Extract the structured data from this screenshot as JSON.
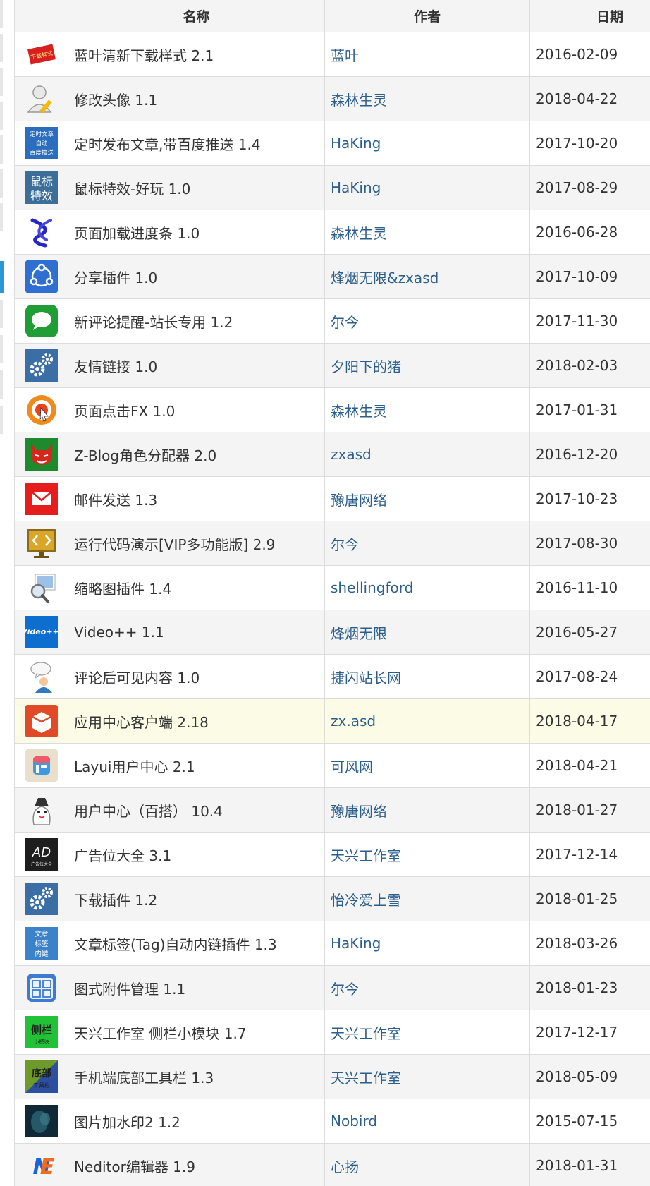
{
  "table": {
    "headers": {
      "name": "名称",
      "author": "作者",
      "date": "日期"
    },
    "rows": [
      {
        "icon": "download-style-icon",
        "name": "蓝叶清新下载样式 2.1",
        "author": "蓝叶",
        "date": "2016-02-09",
        "icon_text": "下载样式"
      },
      {
        "icon": "edit-avatar-icon",
        "name": "修改头像 1.1",
        "author": "森林生灵",
        "date": "2018-04-22"
      },
      {
        "icon": "scheduled-publish-icon",
        "name": "定时发布文章,带百度推送 1.4",
        "author": "HaKing",
        "date": "2017-10-20",
        "icon_text": "定时文章 自动 百度推送"
      },
      {
        "icon": "mouse-effect-icon",
        "name": "鼠标特效-好玩 1.0",
        "author": "HaKing",
        "date": "2017-08-29",
        "icon_text": "鼠标 特效"
      },
      {
        "icon": "loading-progress-icon",
        "name": "页面加载进度条 1.0",
        "author": "森林生灵",
        "date": "2016-06-28"
      },
      {
        "icon": "share-icon",
        "name": "分享插件 1.0",
        "author": "烽烟无限&zxasd",
        "date": "2017-10-09"
      },
      {
        "icon": "chat-bubble-icon",
        "name": "新评论提醒-站长专用 1.2",
        "author": "尔今",
        "date": "2017-11-30"
      },
      {
        "icon": "gears-icon",
        "name": "友情链接 1.0",
        "author": "夕阳下的猪",
        "date": "2018-02-03"
      },
      {
        "icon": "click-target-icon",
        "name": "页面点击FX 1.0",
        "author": "森林生灵",
        "date": "2017-01-31"
      },
      {
        "icon": "devil-icon",
        "name": "Z-Blog角色分配器 2.0",
        "author": "zxasd",
        "date": "2016-12-20"
      },
      {
        "icon": "mail-icon",
        "name": "邮件发送 1.3",
        "author": "豫唐网络",
        "date": "2017-10-23"
      },
      {
        "icon": "code-monitor-icon",
        "name": "运行代码演示[VIP多功能版] 2.9",
        "author": "尔今",
        "date": "2017-08-30"
      },
      {
        "icon": "thumbnail-magnifier-icon",
        "name": "缩略图插件 1.4",
        "author": "shellingford",
        "date": "2016-11-10"
      },
      {
        "icon": "video-icon",
        "name": "Video++ 1.1",
        "author": "烽烟无限",
        "date": "2016-05-27",
        "icon_text": "Video++"
      },
      {
        "icon": "comment-user-icon",
        "name": "评论后可见内容 1.0",
        "author": "捷闪站长网",
        "date": "2017-08-24"
      },
      {
        "icon": "app-center-box-icon",
        "name": "应用中心客户端 2.18",
        "author": "zx.asd",
        "date": "2018-04-17"
      },
      {
        "icon": "layui-user-icon",
        "name": "Layui用户中心 2.1",
        "author": "可风网",
        "date": "2018-04-21"
      },
      {
        "icon": "user-center-mascot-icon",
        "name": "用户中心（百搭） 10.4",
        "author": "豫唐网络",
        "date": "2018-01-27"
      },
      {
        "icon": "ad-icon",
        "name": "广告位大全 3.1",
        "author": "天兴工作室",
        "date": "2017-12-14",
        "icon_text": "AD",
        "icon_subtext": "广告位大全"
      },
      {
        "icon": "gears-icon",
        "name": "下载插件 1.2",
        "author": "怡冷爱上雪",
        "date": "2018-01-25"
      },
      {
        "icon": "tag-link-icon",
        "name": "文章标签(Tag)自动内链插件 1.3",
        "author": "HaKing",
        "date": "2018-03-26",
        "icon_text": "文章 标签 内链"
      },
      {
        "icon": "attachment-grid-icon",
        "name": "图式附件管理 1.1",
        "author": "尔今",
        "date": "2018-01-23"
      },
      {
        "icon": "sidebar-block-icon",
        "name": "天兴工作室 侧栏小模块 1.7",
        "author": "天兴工作室",
        "date": "2017-12-17",
        "icon_text": "侧栏",
        "icon_subtext": "小模块"
      },
      {
        "icon": "bottom-toolbar-icon",
        "name": "手机端底部工具栏 1.3",
        "author": "天兴工作室",
        "date": "2018-05-09",
        "icon_text": "底部",
        "icon_subtext": "工具栏"
      },
      {
        "icon": "watermark-image-icon",
        "name": "图片加水印2 1.2",
        "author": "Nobird",
        "date": "2015-07-15"
      },
      {
        "icon": "neditor-icon",
        "name": "Neditor编辑器 1.9",
        "author": "心扬",
        "date": "2018-01-31",
        "icon_text": "NE"
      }
    ]
  },
  "colors": {
    "link": "#2c5e8c",
    "header_bg": "#f4f4f4",
    "row_alt_bg": "#f4f4f4",
    "row_highlight_bg": "#fcfce6",
    "border": "#dcdcdc",
    "rail_active": "#2a98d4"
  }
}
